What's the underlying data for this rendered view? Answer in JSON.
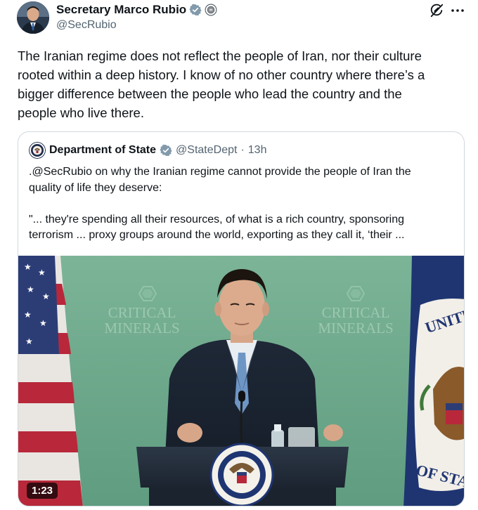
{
  "author": {
    "name": "Secretary Marco Rubio",
    "handle": "@SecRubio",
    "verified_badge_color": "#829aab",
    "affiliate_badge_icon": "us-government-seal-icon"
  },
  "tweet": {
    "text": "The Iranian regime does not reflect the people of Iran, nor their culture\nrooted within a deep history. I know of no other country where there’s a\nbigger difference between the people who lead the country and the\npeople who live there."
  },
  "quoted": {
    "name": "Department of State",
    "handle": "@StateDept",
    "separator": "·",
    "time": "13h",
    "verified_badge_color": "#829aab",
    "text": ".@SecRubio on why the Iranian regime cannot provide the people of Iran the\nquality of life they deserve:\n\n\"... they're spending all their resources, of what is a rich country, sponsoring\nterrorism ... proxy groups around the world, exporting as they call it, ‘their ...",
    "video": {
      "duration": "1:23",
      "backdrop_text_left": "CRITICAL MINERALS",
      "backdrop_text_right": "CRITICAL MINERALS",
      "flag_text": "UNITE",
      "flag_text_bottom": "OF STA",
      "podium_seal_text": "DEPARTMENT OF STATE · UNITED STATES OF AMERICA"
    }
  },
  "icons": {
    "grok": "grok-icon",
    "more": "more-icon"
  },
  "colors": {
    "text": "#0f1419",
    "secondary": "#536471",
    "border": "#cfd9de",
    "backdrop_green": "#6aa88a"
  }
}
